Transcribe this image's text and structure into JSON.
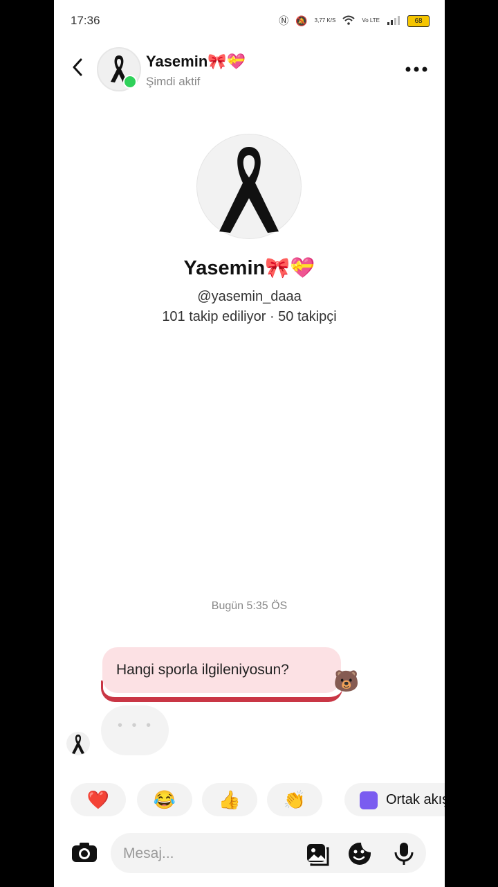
{
  "status_bar": {
    "time": "17:36",
    "net_speed": "3,77 K/S",
    "network_type": "Vo LTE",
    "battery": "68"
  },
  "header": {
    "name": "Yasemin🎀💝",
    "status": "Şimdi aktif"
  },
  "profile": {
    "name": "Yasemin🎀💝",
    "handle": "@yasemin_daaa",
    "stats": "101 takip ediliyor · 50 takipçi"
  },
  "chat": {
    "timestamp": "Bugün 5:35 ÖS",
    "messages": [
      {
        "text": "Hangi sporla ilgileniyosun?",
        "sticker": "🐻"
      }
    ],
    "typing_indicator": "• • •"
  },
  "reactions": [
    "❤️",
    "😂",
    "👍",
    "👏"
  ],
  "ortak_label": "Ortak akış",
  "composer": {
    "placeholder": "Mesaj..."
  },
  "colors": {
    "online": "#2fd15a",
    "bubble": "#fce1e4",
    "accent_line": "#c93645"
  }
}
